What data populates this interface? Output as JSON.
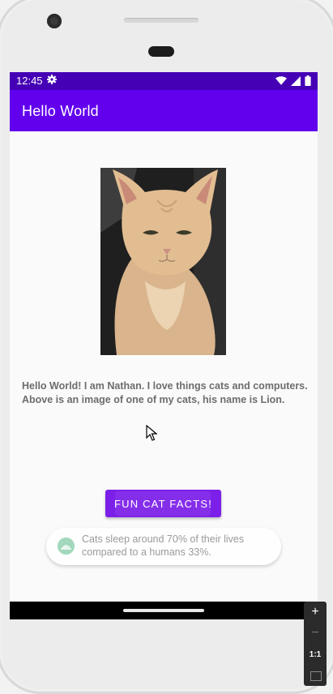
{
  "status_bar": {
    "time": "12:45"
  },
  "app_bar": {
    "title": "Hello World"
  },
  "main": {
    "intro_text": "Hello World! I am Nathan. I love things cats and computers. Above is an image of one of my cats, his name is Lion.",
    "fact_button_label": "FUN CAT FACTS!"
  },
  "toast": {
    "message": "Cats sleep around 70% of their lives compared to a humans 33%."
  },
  "zoom_controls": {
    "zoom_in": "+",
    "zoom_out": "−",
    "reset": "1:1"
  },
  "colors": {
    "status_bar": "#4500b5",
    "app_bar": "#6200ee",
    "button": "#7c1fe9"
  },
  "icons": {
    "status": [
      "gear-icon",
      "wifi-icon",
      "signal-icon",
      "battery-icon"
    ],
    "toast": "app-icon",
    "zoom_fit": "fit-screen-icon"
  }
}
